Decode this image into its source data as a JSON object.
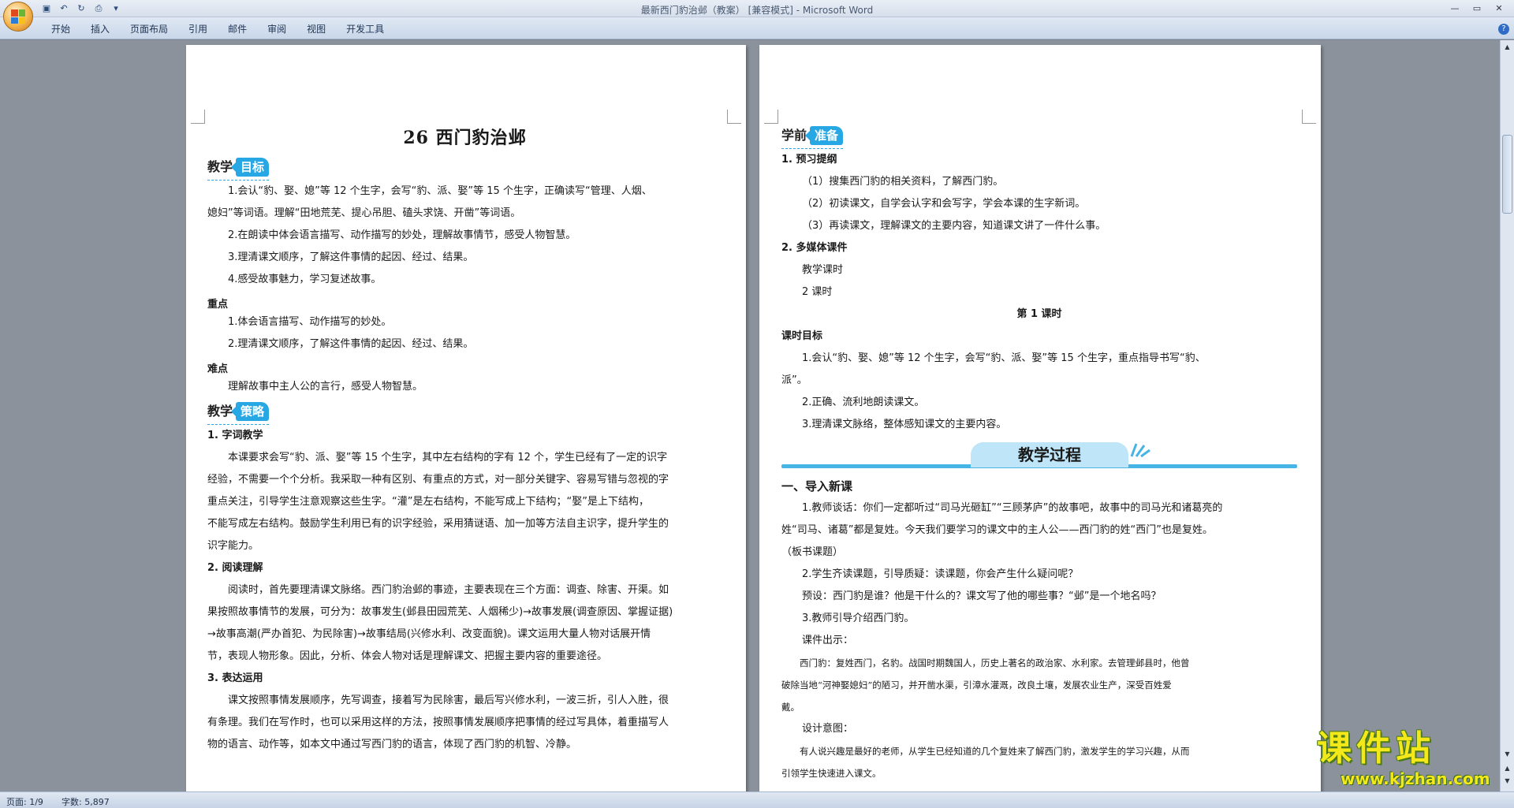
{
  "window": {
    "title": "最新西门豹治邺（教案） [兼容模式] - Microsoft Word"
  },
  "ribbon": {
    "tabs": [
      "开始",
      "插入",
      "页面布局",
      "引用",
      "邮件",
      "审阅",
      "视图",
      "开发工具"
    ],
    "help": "?"
  },
  "left_page": {
    "title": "26 西门豹治邺",
    "goal_head_a": "教学",
    "goal_head_b": "目标",
    "goals": [
      "1.会认“豹、娶、媳”等 12 个生字，会写“豹、派、娶”等 15 个生字，正确读写“管理、人烟、",
      "媳妇”等词语。理解“田地荒芜、提心吊胆、磕头求饶、开凿”等词语。",
      "2.在朗读中体会语言描写、动作描写的妙处，理解故事情节，感受人物智慧。",
      "3.理清课文顺序，了解这件事情的起因、经过、结果。",
      "4.感受故事魅力，学习复述故事。"
    ],
    "key_label": "重点",
    "key_points": [
      "1.体会语言描写、动作描写的妙处。",
      "2.理清课文顺序，了解这件事情的起因、经过、结果。"
    ],
    "diff_label": "难点",
    "diff_text": "理解故事中主人公的言行，感受人物智慧。",
    "strategy_head_a": "教学",
    "strategy_head_b": "策略",
    "s1_title": "1. 字词教学",
    "s1_lines": [
      "本课要求会写“豹、派、娶”等 15 个生字，其中左右结构的字有 12 个，学生已经有了一定的识字",
      "经验，不需要一个个分析。我采取一种有区别、有重点的方式，对一部分关键字、容易写错与忽视的字",
      "重点关注，引导学生注意观察这些生字。“灌”是左右结构，不能写成上下结构；“娶”是上下结构，",
      "不能写成左右结构。鼓励学生利用已有的识字经验，采用猜谜语、加一加等方法自主识字，提升学生的",
      "识字能力。"
    ],
    "s2_title": "2. 阅读理解",
    "s2_lines": [
      "阅读时，首先要理清课文脉络。西门豹治邺的事迹，主要表现在三个方面：调查、除害、开渠。如",
      "果按照故事情节的发展，可分为：故事发生(邺县田园荒芜、人烟稀少)→故事发展(调查原因、掌握证据)",
      "→故事高潮(严办首犯、为民除害)→故事结局(兴修水利、改变面貌)。课文运用大量人物对话展开情",
      "节，表现人物形象。因此，分析、体会人物对话是理解课文、把握主要内容的重要途径。"
    ],
    "s3_title": "3. 表达运用",
    "s3_lines": [
      "课文按照事情发展顺序，先写调查，接着写为民除害，最后写兴修水利，一波三折，引人入胜，很",
      "有条理。我们在写作时，也可以采用这样的方法，按照事情发展顺序把事情的经过写具体，着重描写人",
      "物的语言、动作等，如本文中通过写西门豹的语言，体现了西门豹的机智、冷静。"
    ]
  },
  "right_page": {
    "prep_head_a": "学前",
    "prep_head_b": "准备",
    "p1_title": "1. 预习提纲",
    "p1_items": [
      "（1）搜集西门豹的相关资料，了解西门豹。",
      "（2）初读课文，自学会认字和会写字，学会本课的生字新词。",
      "（3）再读课文，理解课文的主要内容，知道课文讲了一件什么事。"
    ],
    "p2_title": "2. 多媒体课件",
    "p2_items": [
      "教学课时",
      "2 课时"
    ],
    "lesson_title": "第 1 课时",
    "goal_label": "课时目标",
    "goal_lines": [
      "1.会认“豹、娶、媳”等 12 个生字，会写“豹、派、娶”等 15 个生字，重点指导书写“豹、",
      "派”。",
      "2.正确、流利地朗读课文。",
      "3.理清课文脉络，整体感知课文的主要内容。"
    ],
    "banner": "教学过程",
    "sec1_title": "一、导入新课",
    "sec1_lines": [
      "1.教师谈话：你们一定都听过“司马光砸缸”“三顾茅庐”的故事吧，故事中的司马光和诸葛亮的",
      "姓“司马、诸葛”都是复姓。今天我们要学习的课文中的主人公——西门豹的姓“西门”也是复姓。",
      "（板书课题）",
      "2.学生齐读课题，引导质疑：读课题，你会产生什么疑问呢？",
      "预设：西门豹是谁？他是干什么的？课文写了他的哪些事？“邺”是一个地名吗？",
      "3.教师引导介绍西门豹。",
      "课件出示："
    ],
    "quote_lines": [
      "西门豹：复姓西门，名豹。战国时期魏国人，历史上著名的政治家、水利家。去管理邺县时，他曾",
      "破除当地“河神娶媳妇”的陋习，并开凿水渠，引漳水灌溉，改良土壤，发展农业生产，深受百姓爱",
      "戴。"
    ],
    "design_label": "设计意图：",
    "design_lines": [
      "有人说兴趣是最好的老师，从学生已经知道的几个复姓来了解西门豹，激发学生的学习兴趣，从而",
      "引领学生快速进入课文。"
    ]
  },
  "status": {
    "page": "页面: 1/9",
    "words": "字数: 5,897"
  },
  "watermark": {
    "text": "课件站",
    "url": "www.kjzhan.com"
  },
  "colors": {
    "accent": "#27a7e3",
    "banner_bg": "#bfe6f8",
    "watermark": "#f3e81a"
  }
}
